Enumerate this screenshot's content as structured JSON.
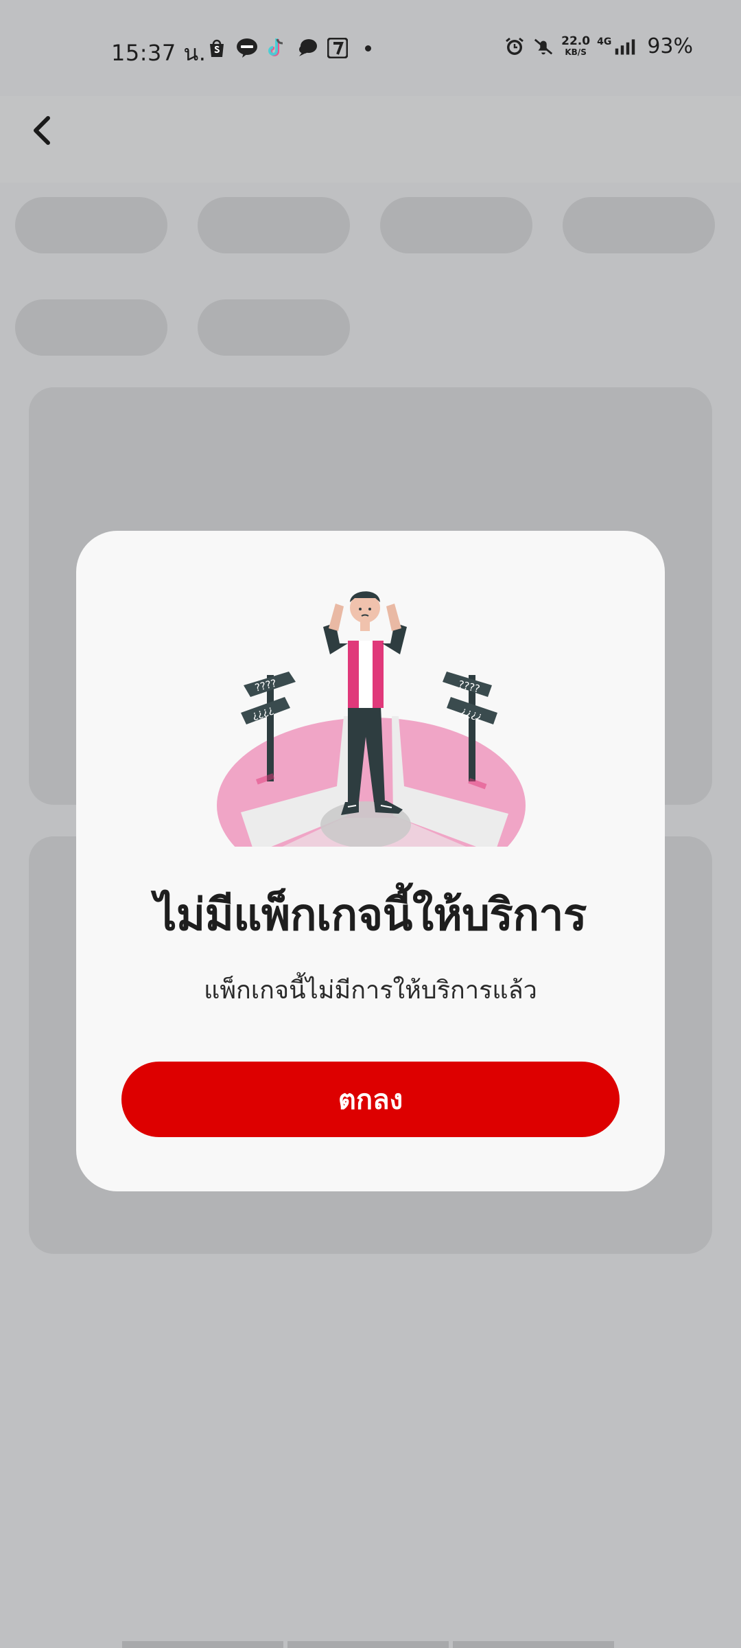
{
  "status_bar": {
    "time": "15:37 น.",
    "net_speed_value": "22.0",
    "net_speed_unit": "KB/S",
    "network_type": "4G",
    "battery": "93%",
    "left_icons": [
      "shopee-icon",
      "line-icon",
      "tiktok-icon",
      "chat-icon",
      "seven-eleven-icon"
    ],
    "right_icons": [
      "alarm-icon",
      "mute-icon",
      "signal-icon"
    ]
  },
  "header": {
    "back_icon": "chevron-left-icon"
  },
  "dialog": {
    "illustration": "confused-person-crossroads-illustration",
    "sign_text_top": "????",
    "sign_text_bottom": "¿¿¿¿",
    "title": "ไม่มีแพ็กเกจนี้ให้บริการ",
    "message": "แพ็กเกจนี้ไม่มีการให้บริการแล้ว",
    "ok_label": "ตกลง"
  },
  "colors": {
    "accent": "#dd0000",
    "overlay_background": "#bfc0c2",
    "dialog_background": "#f8f8f8",
    "illustration_pink": "#f0a5c6",
    "illustration_magenta": "#e0397a"
  }
}
